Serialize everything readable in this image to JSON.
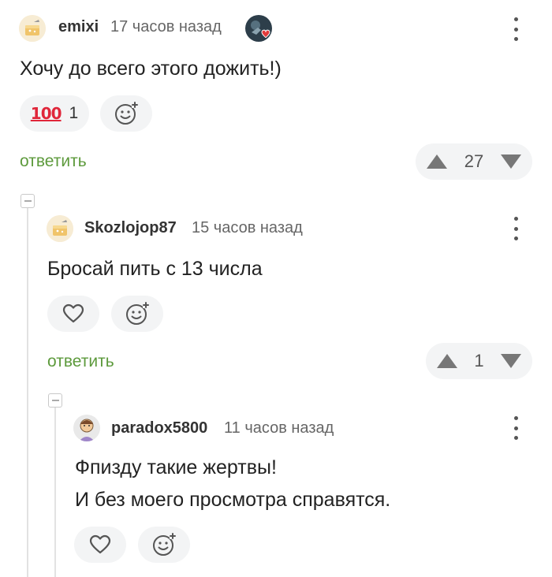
{
  "comments": [
    {
      "username": "emixi",
      "time": "17 часов назад",
      "text": "Хочу до всего этого дожить!)",
      "reaction_emoji": "100",
      "reaction_count": "1",
      "reply_label": "ответить",
      "rating": "27"
    },
    {
      "username": "Skozlojop87",
      "time": "15 часов назад",
      "text": "Бросай пить с 13 числа",
      "reply_label": "ответить",
      "rating": "1"
    },
    {
      "username": "paradox5800",
      "time": "11 часов назад",
      "text_line1": "Фпизду такие жертвы!",
      "text_line2": "И без моего просмотра справятся."
    }
  ],
  "icons": {
    "menu": "more-vertical-icon",
    "add_reaction": "add-emoji-icon",
    "like": "heart-icon",
    "upvote": "triangle-up-icon",
    "downvote": "triangle-down-icon",
    "badge": "heart-badge-icon"
  },
  "colors": {
    "reply": "#5d9a3c",
    "pill_bg": "#f3f4f5",
    "hundred": "#e0263a"
  }
}
